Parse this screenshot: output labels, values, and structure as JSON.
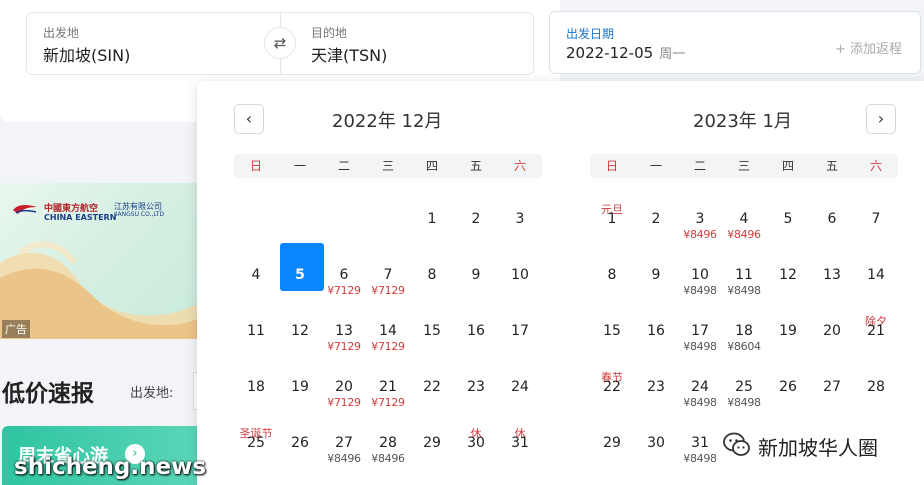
{
  "search": {
    "from_label": "出发地",
    "from_value": "新加坡(SIN)",
    "to_label": "目的地",
    "to_value": "天津(TSN)",
    "date_label": "出发日期",
    "date_value": "2022-12-05",
    "date_weekday": "周一",
    "add_return": "+ 添加返程",
    "swap_icon": "swap-arrows-icon"
  },
  "ad": {
    "airline_cn": "中國東方航空",
    "airline_en": "CHINA EASTERN",
    "airline_sub": "江苏有限公司",
    "airline_sub_en": "JIANGSU CO.,LTD",
    "tag": "广告"
  },
  "section": {
    "title": "低价速报",
    "depart_label": "出发地:",
    "banner_text": "周末省心游"
  },
  "calendar": {
    "prev_icon": "chevron-left-icon",
    "next_icon": "chevron-right-icon",
    "months": [
      {
        "title": "2022年 12月",
        "weekdays": [
          "日",
          "一",
          "二",
          "三",
          "四",
          "五",
          "六"
        ]
      },
      {
        "title": "2023年 1月",
        "weekdays": [
          "日",
          "一",
          "二",
          "三",
          "四",
          "五",
          "六"
        ]
      }
    ],
    "dec_days": [
      {
        "d": "1",
        "col": 4,
        "row": 0
      },
      {
        "d": "2",
        "col": 5,
        "row": 0
      },
      {
        "d": "3",
        "col": 6,
        "row": 0
      },
      {
        "d": "4",
        "col": 0,
        "row": 1
      },
      {
        "d": "5",
        "col": 1,
        "row": 1,
        "selected": true
      },
      {
        "d": "6",
        "col": 2,
        "row": 1,
        "price": "¥7129",
        "pc": "red"
      },
      {
        "d": "7",
        "col": 3,
        "row": 1,
        "price": "¥7129",
        "pc": "red"
      },
      {
        "d": "8",
        "col": 4,
        "row": 1
      },
      {
        "d": "9",
        "col": 5,
        "row": 1
      },
      {
        "d": "10",
        "col": 6,
        "row": 1
      },
      {
        "d": "11",
        "col": 0,
        "row": 2
      },
      {
        "d": "12",
        "col": 1,
        "row": 2
      },
      {
        "d": "13",
        "col": 2,
        "row": 2,
        "price": "¥7129",
        "pc": "red"
      },
      {
        "d": "14",
        "col": 3,
        "row": 2,
        "price": "¥7129",
        "pc": "red"
      },
      {
        "d": "15",
        "col": 4,
        "row": 2
      },
      {
        "d": "16",
        "col": 5,
        "row": 2
      },
      {
        "d": "17",
        "col": 6,
        "row": 2
      },
      {
        "d": "18",
        "col": 0,
        "row": 3
      },
      {
        "d": "19",
        "col": 1,
        "row": 3
      },
      {
        "d": "20",
        "col": 2,
        "row": 3,
        "price": "¥7129",
        "pc": "red"
      },
      {
        "d": "21",
        "col": 3,
        "row": 3,
        "price": "¥7129",
        "pc": "red"
      },
      {
        "d": "22",
        "col": 4,
        "row": 3
      },
      {
        "d": "23",
        "col": 5,
        "row": 3
      },
      {
        "d": "24",
        "col": 6,
        "row": 3
      },
      {
        "d": "25",
        "col": 0,
        "row": 4,
        "hol": "圣诞节"
      },
      {
        "d": "26",
        "col": 1,
        "row": 4
      },
      {
        "d": "27",
        "col": 2,
        "row": 4,
        "price": "¥8496",
        "pc": "gray"
      },
      {
        "d": "28",
        "col": 3,
        "row": 4,
        "price": "¥8496",
        "pc": "gray"
      },
      {
        "d": "29",
        "col": 4,
        "row": 4
      },
      {
        "d": "30",
        "col": 5,
        "row": 4,
        "hol": "休"
      },
      {
        "d": "31",
        "col": 6,
        "row": 4,
        "hol": "休"
      }
    ],
    "jan_days": [
      {
        "d": "1",
        "col": 0,
        "row": 0,
        "hol": "元旦"
      },
      {
        "d": "2",
        "col": 1,
        "row": 0
      },
      {
        "d": "3",
        "col": 2,
        "row": 0,
        "price": "¥8496",
        "pc": "red"
      },
      {
        "d": "4",
        "col": 3,
        "row": 0,
        "price": "¥8496",
        "pc": "red"
      },
      {
        "d": "5",
        "col": 4,
        "row": 0
      },
      {
        "d": "6",
        "col": 5,
        "row": 0
      },
      {
        "d": "7",
        "col": 6,
        "row": 0
      },
      {
        "d": "8",
        "col": 0,
        "row": 1
      },
      {
        "d": "9",
        "col": 1,
        "row": 1
      },
      {
        "d": "10",
        "col": 2,
        "row": 1,
        "price": "¥8498",
        "pc": "gray"
      },
      {
        "d": "11",
        "col": 3,
        "row": 1,
        "price": "¥8498",
        "pc": "gray"
      },
      {
        "d": "12",
        "col": 4,
        "row": 1
      },
      {
        "d": "13",
        "col": 5,
        "row": 1
      },
      {
        "d": "14",
        "col": 6,
        "row": 1
      },
      {
        "d": "15",
        "col": 0,
        "row": 2
      },
      {
        "d": "16",
        "col": 1,
        "row": 2
      },
      {
        "d": "17",
        "col": 2,
        "row": 2,
        "price": "¥8498",
        "pc": "gray"
      },
      {
        "d": "18",
        "col": 3,
        "row": 2,
        "price": "¥8604",
        "pc": "gray"
      },
      {
        "d": "19",
        "col": 4,
        "row": 2
      },
      {
        "d": "20",
        "col": 5,
        "row": 2
      },
      {
        "d": "21",
        "col": 6,
        "row": 2,
        "hol": "除夕"
      },
      {
        "d": "22",
        "col": 0,
        "row": 3,
        "hol": "春节"
      },
      {
        "d": "23",
        "col": 1,
        "row": 3
      },
      {
        "d": "24",
        "col": 2,
        "row": 3,
        "price": "¥8498",
        "pc": "gray"
      },
      {
        "d": "25",
        "col": 3,
        "row": 3,
        "price": "¥8498",
        "pc": "gray"
      },
      {
        "d": "26",
        "col": 4,
        "row": 3
      },
      {
        "d": "27",
        "col": 5,
        "row": 3
      },
      {
        "d": "28",
        "col": 6,
        "row": 3
      },
      {
        "d": "29",
        "col": 0,
        "row": 4
      },
      {
        "d": "30",
        "col": 1,
        "row": 4
      },
      {
        "d": "31",
        "col": 2,
        "row": 4,
        "price": "¥8498",
        "pc": "gray"
      }
    ]
  },
  "watermark": {
    "site": "shicheng.news",
    "wechat": "新加坡华人圈"
  },
  "colors": {
    "accent": "#0a84ff",
    "holiday": "#d23c3c",
    "link": "#1a73c8"
  }
}
